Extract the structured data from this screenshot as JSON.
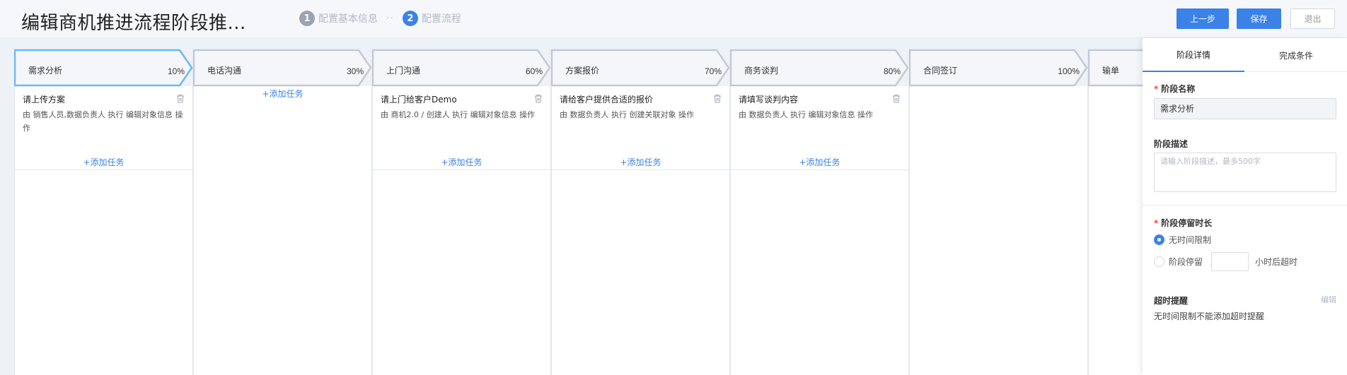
{
  "header": {
    "title": "编辑商机推进流程阶段推...",
    "steps": [
      {
        "num": "1",
        "label": "配置基本信息"
      },
      {
        "num": "2",
        "label": "配置流程"
      }
    ],
    "step_separator": "··",
    "buttons": {
      "prev": "上一步",
      "save": "保存",
      "exit": "退出"
    }
  },
  "stages": [
    {
      "name": "需求分析",
      "percent": "10%",
      "tasks": [
        {
          "title": "请上传方案",
          "desc": "由 销售人员,数据负责人 执行 编辑对象信息 操作"
        }
      ],
      "add_label": "+添加任务"
    },
    {
      "name": "电话沟通",
      "percent": "30%",
      "tasks": [],
      "add_label": "+添加任务"
    },
    {
      "name": "上门沟通",
      "percent": "60%",
      "tasks": [
        {
          "title": "请上门给客户Demo",
          "desc": "由 商机2.0 / 创建人 执行 编辑对象信息 操作"
        }
      ],
      "add_label": "+添加任务"
    },
    {
      "name": "方案报价",
      "percent": "70%",
      "tasks": [
        {
          "title": "请给客户提供合适的报价",
          "desc": "由 数据负责人 执行 创建关联对象 操作"
        }
      ],
      "add_label": "+添加任务"
    },
    {
      "name": "商务谈判",
      "percent": "80%",
      "tasks": [
        {
          "title": "请填写谈判内容",
          "desc": "由 数据负责人 执行 编辑对象信息 操作"
        }
      ],
      "add_label": "+添加任务"
    },
    {
      "name": "合同签订",
      "percent": "100%",
      "tasks": [],
      "add_label": ""
    },
    {
      "name": "输单",
      "percent": "",
      "tasks": [],
      "add_label": ""
    }
  ],
  "panel": {
    "tabs": [
      "阶段详情",
      "完成条件"
    ],
    "stage_name_label": "阶段名称",
    "stage_name_value": "需求分析",
    "stage_desc_label": "阶段描述",
    "stage_desc_placeholder": "请输入阶段描述，最多500字",
    "stay_label": "阶段停留时长",
    "radio_no_limit": "无时间限制",
    "radio_stay": "阶段停留",
    "hours_suffix": "小时后超时",
    "timeout_label": "超时提醒",
    "edit_label": "编辑",
    "timeout_text": "无时间限制不能添加超时提醒"
  },
  "colors": {
    "accent": "#3a82e8",
    "active_stage_border": "#6bb8f0",
    "stage_border": "#c3c9d6",
    "stage_fill": "#f4f6f9"
  }
}
